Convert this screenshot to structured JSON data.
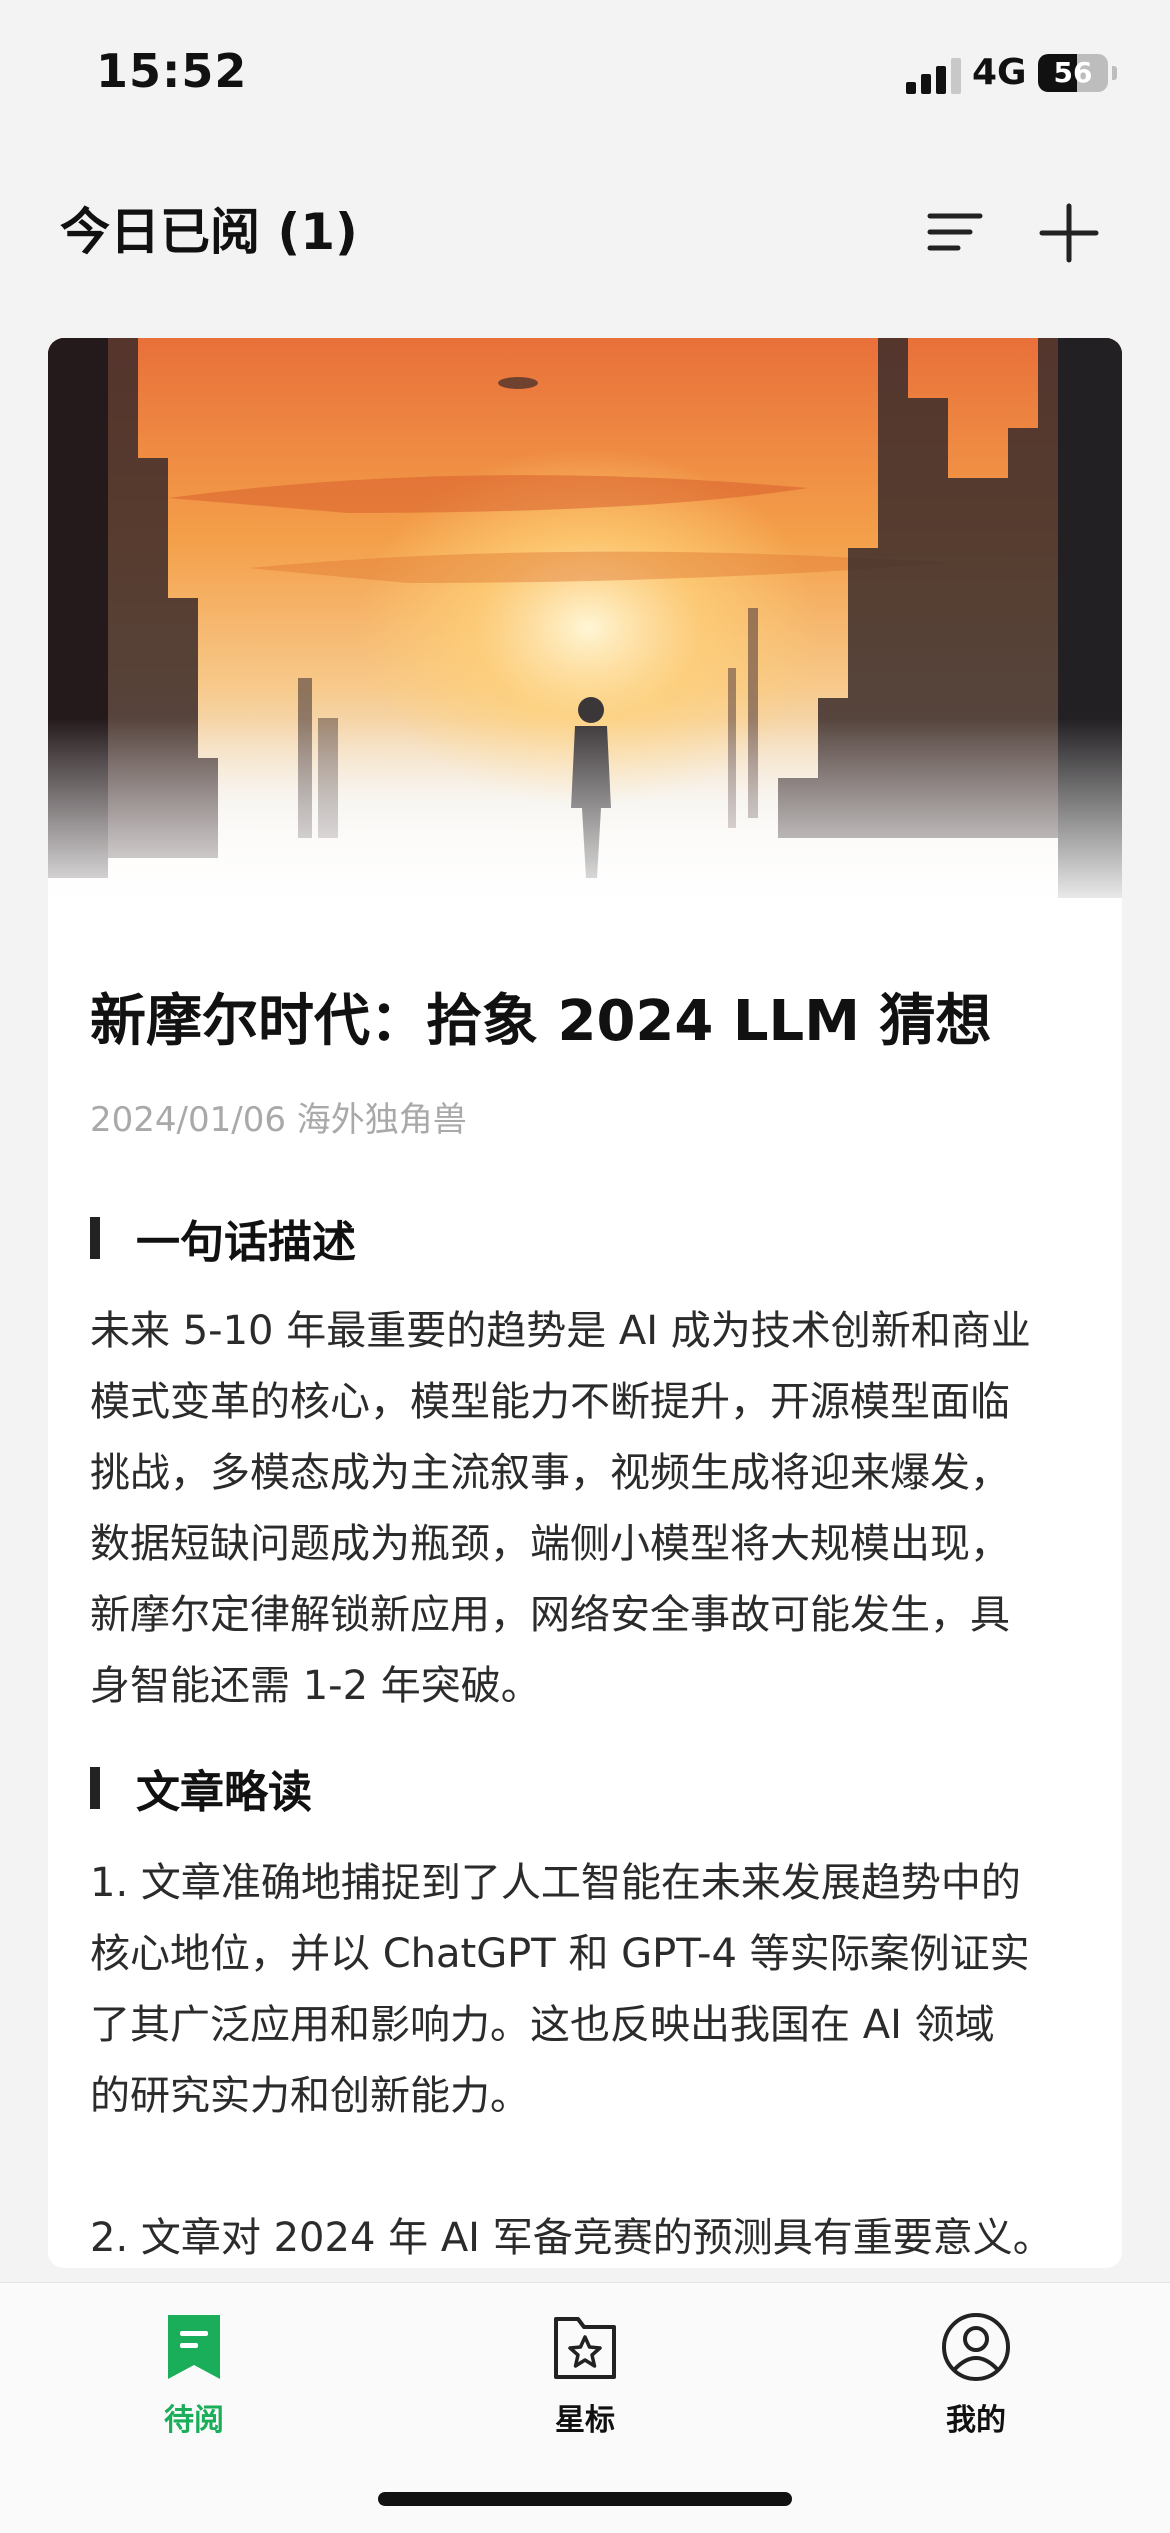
{
  "status_bar": {
    "time": "15:52",
    "network": "4G",
    "battery": "56",
    "battery_level": 0.56
  },
  "header": {
    "title": "今日已阅 (1)"
  },
  "article": {
    "title": "新摩尔时代：拾象 2024 LLM 猜想",
    "meta": "2024/01/06 海外独角兽",
    "sections": [
      {
        "heading": "一句话描述",
        "lines": [
          "未来 5-10 年最重要的趋势是 AI 成为技术创新和商业",
          "模式变革的核心，模型能力不断提升，开源模型面临",
          "挑战，多模态成为主流叙事，视频生成将迎来爆发，",
          "数据短缺问题成为瓶颈，端侧小模型将大规模出现，",
          "新摩尔定律解锁新应用，网络安全事故可能发生，具",
          "身智能还需 1-2 年突破。"
        ]
      },
      {
        "heading": "文章略读",
        "lines": [
          "1. 文章准确地捕捉到了人工智能在未来发展趋势中的",
          "核心地位，并以 ChatGPT 和 GPT-4 等实际案例证实",
          "了其广泛应用和影响力。这也反映出我国在 AI 领域",
          "的研究实力和创新能力。",
          "",
          "2. 文章对 2024 年 AI 军备竞赛的预测具有重要意义。"
        ]
      }
    ]
  },
  "tabs": [
    {
      "label": "待阅",
      "icon": "bookmark-icon",
      "active": true
    },
    {
      "label": "星标",
      "icon": "star-folder-icon",
      "active": false
    },
    {
      "label": "我的",
      "icon": "user-icon",
      "active": false
    }
  ],
  "colors": {
    "accent": "#1aad5a",
    "background": "#f3f3f3",
    "card": "#ffffff"
  }
}
